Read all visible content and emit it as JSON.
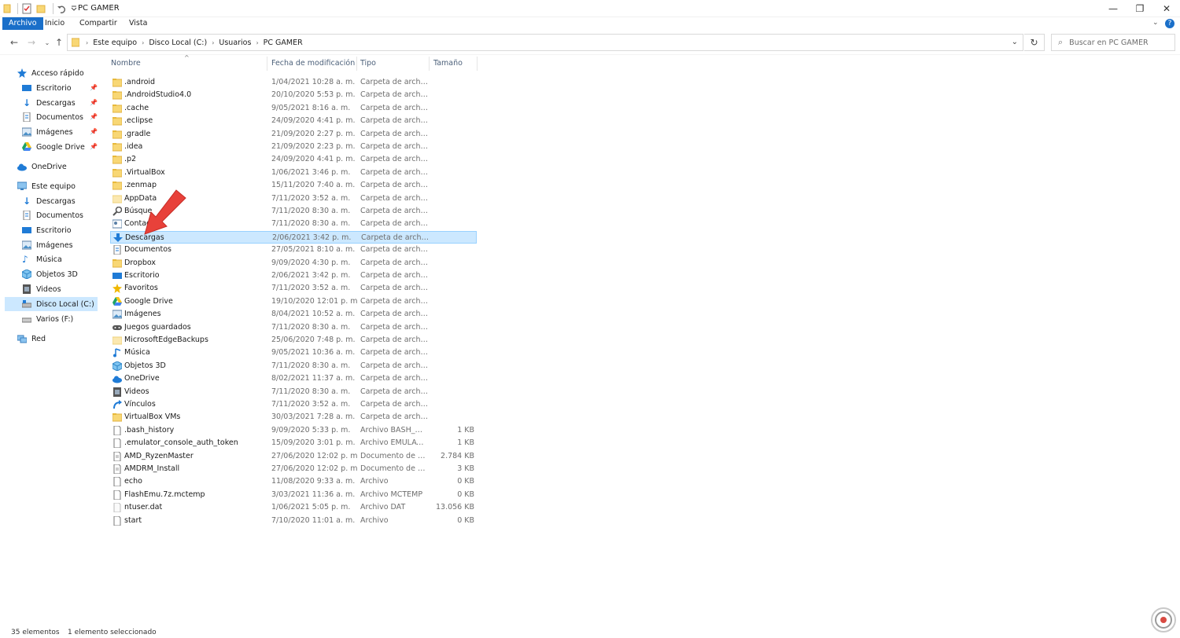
{
  "window": {
    "title": "PC GAMER",
    "minimize": "—",
    "restore": "❐",
    "close": "✕"
  },
  "ribbon": {
    "tabs": [
      "Archivo",
      "Inicio",
      "Compartir",
      "Vista"
    ]
  },
  "navigation": {
    "breadcrumbs": [
      "Este equipo",
      "Disco Local (C:)",
      "Usuarios",
      "PC GAMER"
    ],
    "search_placeholder": "Buscar en PC GAMER"
  },
  "sidebar": {
    "quick_access": "Acceso rápido",
    "quick_items": [
      "Escritorio",
      "Descargas",
      "Documentos",
      "Imágenes",
      "Google Drive"
    ],
    "onedrive": "OneDrive",
    "this_pc": "Este equipo",
    "pc_items": [
      "Descargas",
      "Documentos",
      "Escritorio",
      "Imágenes",
      "Música",
      "Objetos 3D",
      "Videos",
      "Disco Local (C:)",
      "Varios (F:)"
    ],
    "network": "Red"
  },
  "columns": {
    "name": "Nombre",
    "date": "Fecha de modificación",
    "type": "Tipo",
    "size": "Tamaño"
  },
  "files": [
    {
      "name": ".android",
      "date": "1/04/2021 10:28 a. m.",
      "type": "Carpeta de archivos",
      "size": "",
      "icon": "folder-icon"
    },
    {
      "name": ".AndroidStudio4.0",
      "date": "20/10/2020 5:53 p. m.",
      "type": "Carpeta de archivos",
      "size": "",
      "icon": "folder-icon"
    },
    {
      "name": ".cache",
      "date": "9/05/2021 8:16 a. m.",
      "type": "Carpeta de archivos",
      "size": "",
      "icon": "folder-icon"
    },
    {
      "name": ".eclipse",
      "date": "24/09/2020 4:41 p. m.",
      "type": "Carpeta de archivos",
      "size": "",
      "icon": "folder-icon"
    },
    {
      "name": ".gradle",
      "date": "21/09/2020 2:27 p. m.",
      "type": "Carpeta de archivos",
      "size": "",
      "icon": "folder-icon"
    },
    {
      "name": ".idea",
      "date": "21/09/2020 2:23 p. m.",
      "type": "Carpeta de archivos",
      "size": "",
      "icon": "folder-icon"
    },
    {
      "name": ".p2",
      "date": "24/09/2020 4:41 p. m.",
      "type": "Carpeta de archivos",
      "size": "",
      "icon": "folder-icon"
    },
    {
      "name": ".VirtualBox",
      "date": "1/06/2021 3:46 p. m.",
      "type": "Carpeta de archivos",
      "size": "",
      "icon": "folder-icon"
    },
    {
      "name": ".zenmap",
      "date": "15/11/2020 7:40 a. m.",
      "type": "Carpeta de archivos",
      "size": "",
      "icon": "folder-icon"
    },
    {
      "name": "AppData",
      "date": "7/11/2020 3:52 a. m.",
      "type": "Carpeta de archivos",
      "size": "",
      "icon": "hidden-folder-icon"
    },
    {
      "name": "Búsque",
      "date": "7/11/2020 8:30 a. m.",
      "type": "Carpeta de archivos",
      "size": "",
      "icon": "search-folder-icon"
    },
    {
      "name": "Contact",
      "date": "7/11/2020 8:30 a. m.",
      "type": "Carpeta de archivos",
      "size": "",
      "icon": "contacts-icon"
    },
    {
      "name": "Descargas",
      "date": "2/06/2021 3:42 p. m.",
      "type": "Carpeta de archivos",
      "size": "",
      "icon": "download-icon",
      "selected": true
    },
    {
      "name": "Documentos",
      "date": "27/05/2021 8:10 a. m.",
      "type": "Carpeta de archivos",
      "size": "",
      "icon": "documents-icon"
    },
    {
      "name": "Dropbox",
      "date": "9/09/2020 4:30 p. m.",
      "type": "Carpeta de archivos",
      "size": "",
      "icon": "folder-icon"
    },
    {
      "name": "Escritorio",
      "date": "2/06/2021 3:42 p. m.",
      "type": "Carpeta de archivos",
      "size": "",
      "icon": "desktop-icon"
    },
    {
      "name": "Favoritos",
      "date": "7/11/2020 3:52 a. m.",
      "type": "Carpeta de archivos",
      "size": "",
      "icon": "star-icon"
    },
    {
      "name": "Google Drive",
      "date": "19/10/2020 12:01 p. m.",
      "type": "Carpeta de archivos",
      "size": "",
      "icon": "google-drive-icon"
    },
    {
      "name": "Imágenes",
      "date": "8/04/2021 10:52 a. m.",
      "type": "Carpeta de archivos",
      "size": "",
      "icon": "pictures-icon"
    },
    {
      "name": "Juegos guardados",
      "date": "7/11/2020 8:30 a. m.",
      "type": "Carpeta de archivos",
      "size": "",
      "icon": "saved-games-icon"
    },
    {
      "name": "MicrosoftEdgeBackups",
      "date": "25/06/2020 7:48 p. m.",
      "type": "Carpeta de archivos",
      "size": "",
      "icon": "hidden-folder-icon"
    },
    {
      "name": "Música",
      "date": "9/05/2021 10:36 a. m.",
      "type": "Carpeta de archivos",
      "size": "",
      "icon": "music-icon"
    },
    {
      "name": "Objetos 3D",
      "date": "7/11/2020 8:30 a. m.",
      "type": "Carpeta de archivos",
      "size": "",
      "icon": "3d-objects-icon"
    },
    {
      "name": "OneDrive",
      "date": "8/02/2021 11:37 a. m.",
      "type": "Carpeta de archivos",
      "size": "",
      "icon": "onedrive-icon"
    },
    {
      "name": "Videos",
      "date": "7/11/2020 8:30 a. m.",
      "type": "Carpeta de archivos",
      "size": "",
      "icon": "videos-icon"
    },
    {
      "name": "Vínculos",
      "date": "7/11/2020 3:52 a. m.",
      "type": "Carpeta de archivos",
      "size": "",
      "icon": "links-icon"
    },
    {
      "name": "VirtualBox VMs",
      "date": "30/03/2021 7:28 a. m.",
      "type": "Carpeta de archivos",
      "size": "",
      "icon": "folder-icon"
    },
    {
      "name": ".bash_history",
      "date": "9/09/2020 5:33 p. m.",
      "type": "Archivo BASH_HIS...",
      "size": "1 KB",
      "icon": "file-icon"
    },
    {
      "name": ".emulator_console_auth_token",
      "date": "15/09/2020 3:01 p. m.",
      "type": "Archivo EMULATO...",
      "size": "1 KB",
      "icon": "file-icon"
    },
    {
      "name": "AMD_RyzenMaster",
      "date": "27/06/2020 12:02 p. m.",
      "type": "Documento de te...",
      "size": "2.784 KB",
      "icon": "text-file-icon"
    },
    {
      "name": "AMDRM_Install",
      "date": "27/06/2020 12:02 p. m.",
      "type": "Documento de te...",
      "size": "3 KB",
      "icon": "text-file-icon"
    },
    {
      "name": "echo",
      "date": "11/08/2020 9:33 a. m.",
      "type": "Archivo",
      "size": "0 KB",
      "icon": "file-icon"
    },
    {
      "name": "FlashEmu.7z.mctemp",
      "date": "3/03/2021 11:36 a. m.",
      "type": "Archivo MCTEMP",
      "size": "0 KB",
      "icon": "file-icon"
    },
    {
      "name": "ntuser.dat",
      "date": "1/06/2021 5:05 p. m.",
      "type": "Archivo DAT",
      "size": "13.056 KB",
      "icon": "system-file-icon"
    },
    {
      "name": "start",
      "date": "7/10/2020 11:01 a. m.",
      "type": "Archivo",
      "size": "0 KB",
      "icon": "file-icon"
    }
  ],
  "status": {
    "count": "35 elementos",
    "selected": "1 elemento seleccionado"
  },
  "colors": {
    "accent": "#1a6fc9",
    "selection": "#cce8ff",
    "selection_border": "#99d1ff",
    "folder": "#f8d775",
    "annotation_arrow": "#e8413a"
  }
}
